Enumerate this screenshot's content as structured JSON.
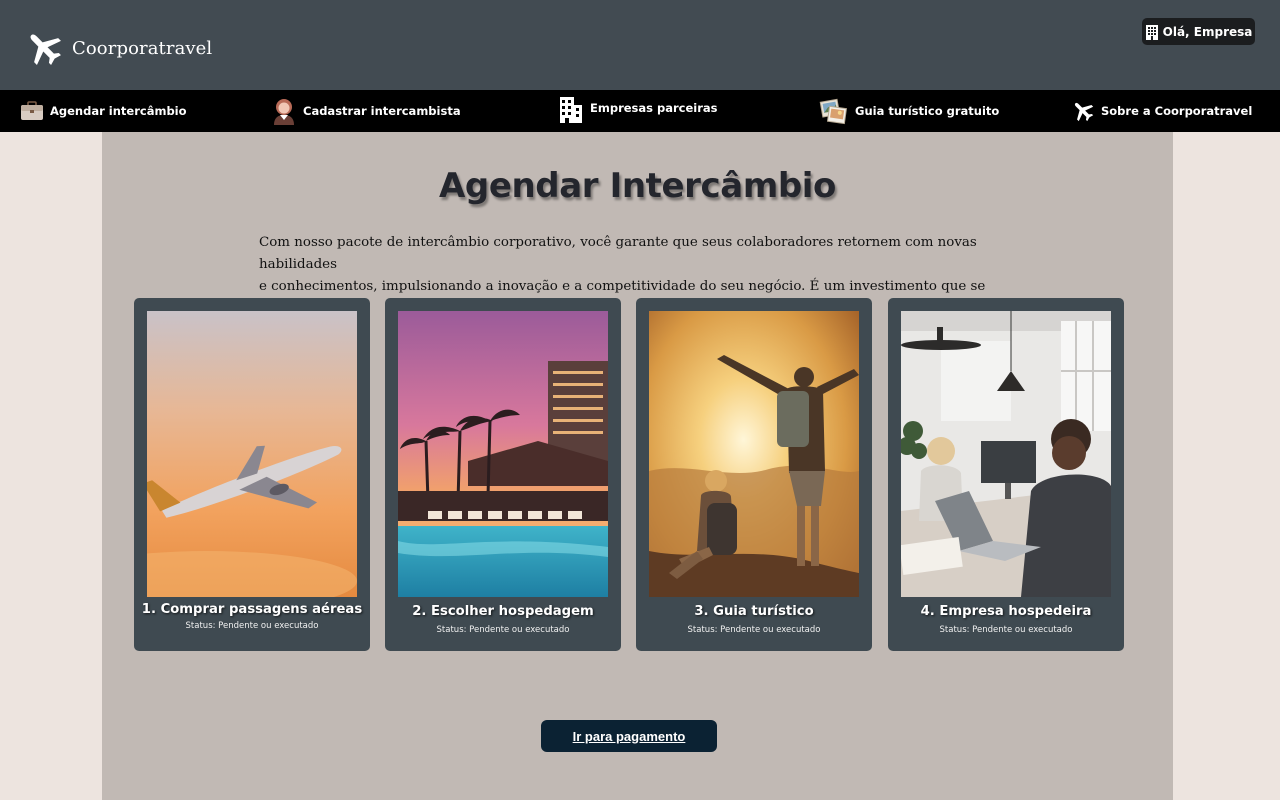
{
  "brand": {
    "name": "Coorporatravel"
  },
  "header": {
    "greeting": "Olá, Empresa"
  },
  "nav": {
    "items": [
      {
        "label": "Agendar intercâmbio",
        "icon": "briefcase-icon"
      },
      {
        "label": "Cadastrar intercambista",
        "icon": "person-icon"
      },
      {
        "label": "Empresas parceiras",
        "icon": "building-icon"
      },
      {
        "label": "Guia turístico gratuito",
        "icon": "photos-icon"
      },
      {
        "label": "Sobre a Coorporatravel",
        "icon": "airplane-icon"
      }
    ]
  },
  "main": {
    "title": "Agendar Intercâmbio",
    "intro_line1": "Com nosso pacote de intercâmbio corporativo, você garante que seus colaboradores retornem com novas habilidades",
    "intro_line2": "e conhecimentos, impulsionando a inovação e a competitividade do seu negócio. É um investimento que se paga!",
    "cards": [
      {
        "title": "1. Comprar passagens aéreas",
        "status": "Status: Pendente ou executado",
        "image": "airplane-sunset-photo"
      },
      {
        "title": "2. Escolher hospedagem",
        "status": "Status: Pendente ou executado",
        "image": "resort-pool-photo"
      },
      {
        "title": "3. Guia turístico",
        "status": "Status: Pendente ou executado",
        "image": "hikers-mountain-photo"
      },
      {
        "title": "4. Empresa hospedeira",
        "status": "Status: Pendente ou executado",
        "image": "office-workers-photo"
      }
    ],
    "pay_button": "Ir para pagamento"
  },
  "colors": {
    "header_bg": "#424b52",
    "nav_bg": "#000000",
    "page_bg": "#ede4df",
    "panel_bg": "#c1b9b4",
    "card_bg": "#3f4a51",
    "button_bg": "#0b2233"
  }
}
